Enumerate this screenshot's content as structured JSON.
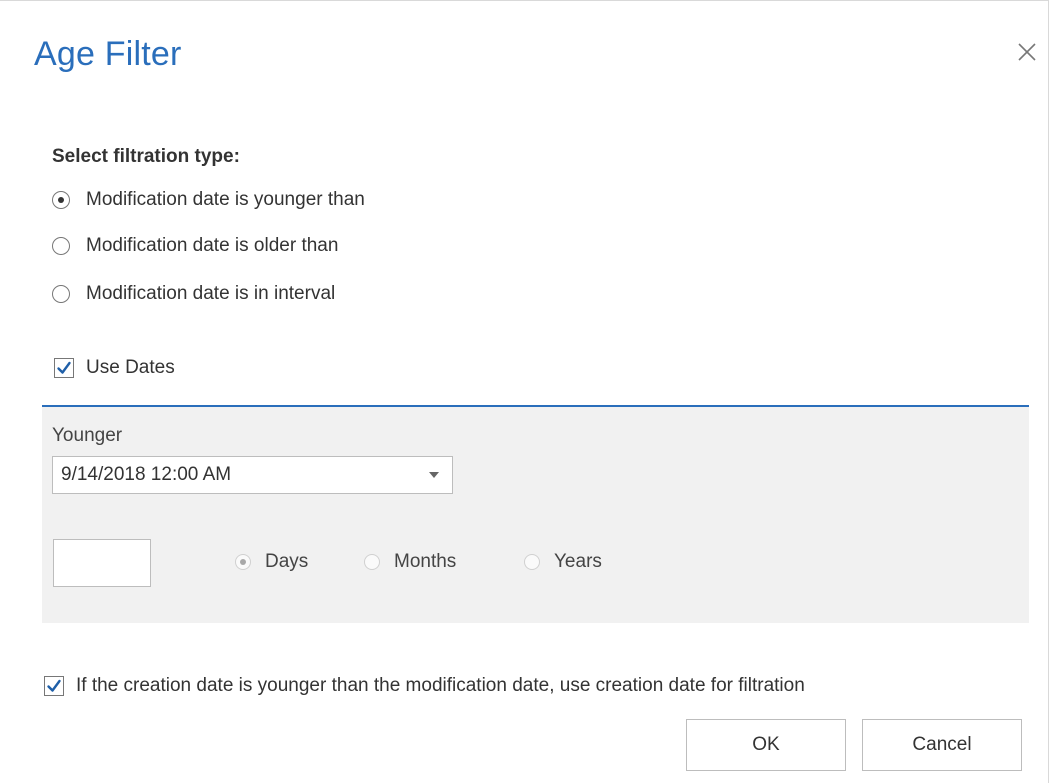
{
  "dialog": {
    "title": "Age Filter",
    "close_icon": "close-icon"
  },
  "filtration": {
    "label": "Select filtration type:",
    "options": [
      {
        "label": "Modification date is younger than",
        "checked": true
      },
      {
        "label": "Modification date is older than",
        "checked": false
      },
      {
        "label": "Modification date is in interval",
        "checked": false
      }
    ]
  },
  "use_dates": {
    "label": "Use Dates",
    "checked": true
  },
  "date_panel": {
    "younger_label": "Younger",
    "date_value": "9/14/2018 12:00 AM",
    "number_value": "",
    "units": [
      {
        "label": "Days",
        "checked": true
      },
      {
        "label": "Months",
        "checked": false
      },
      {
        "label": "Years",
        "checked": false
      }
    ]
  },
  "creation_option": {
    "label": "If the creation date is younger than the modification date, use creation date for filtration",
    "checked": true
  },
  "buttons": {
    "ok": "OK",
    "cancel": "Cancel"
  },
  "colors": {
    "accent": "#2a6ebb",
    "panel_bg": "#f1f1f1",
    "checkmark": "#1f5fa8"
  }
}
